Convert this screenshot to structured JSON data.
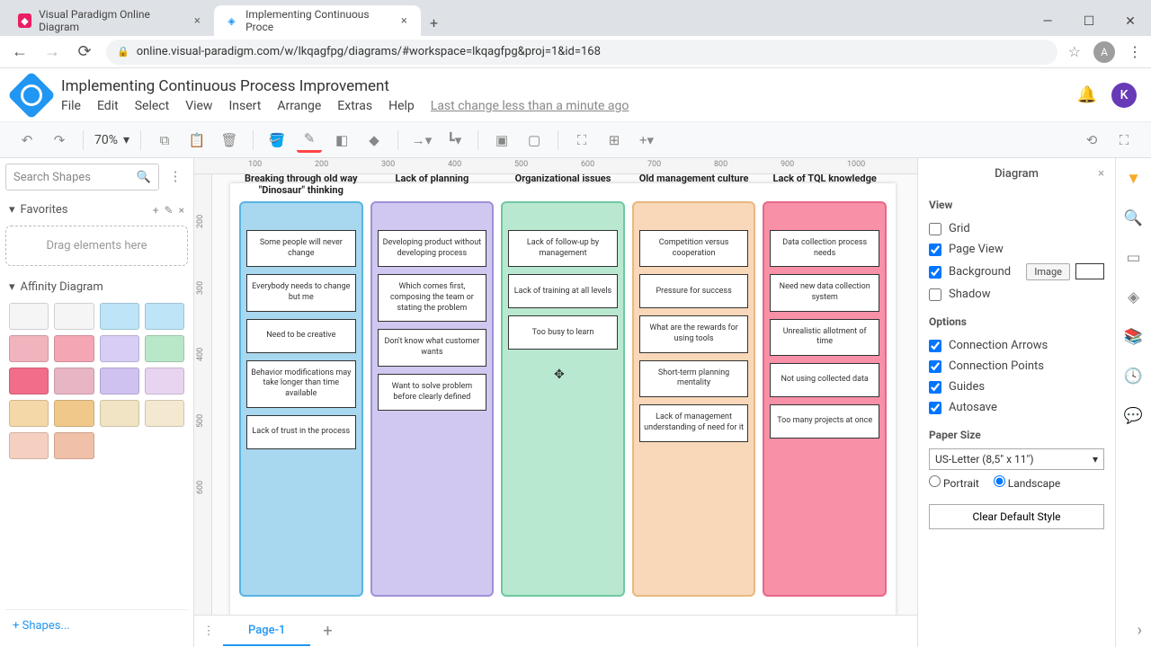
{
  "browser": {
    "tabs": [
      {
        "title": "Visual Paradigm Online Diagram",
        "active": false
      },
      {
        "title": "Implementing Continuous Proce",
        "active": true
      }
    ],
    "url": "online.visual-paradigm.com/w/lkqagfpg/diagrams/#workspace=lkqagfpg&proj=1&id=168",
    "avatar": "A"
  },
  "app": {
    "title": "Implementing Continuous Process Improvement",
    "menus": [
      "File",
      "Edit",
      "Select",
      "View",
      "Insert",
      "Arrange",
      "Extras",
      "Help"
    ],
    "lastChange": "Last change less than a minute ago",
    "userInitial": "K",
    "zoom": "70%"
  },
  "leftPanel": {
    "searchPlaceholder": "Search Shapes",
    "favorites": "Favorites",
    "dropHint": "Drag elements here",
    "sectionName": "Affinity Diagram",
    "moreShapes": "+  Shapes..."
  },
  "rulerH": [
    "100",
    "200",
    "300",
    "400",
    "500",
    "600",
    "700",
    "800",
    "900",
    "1000"
  ],
  "rulerV": [
    "200",
    "300",
    "400",
    "500",
    "600"
  ],
  "columns": [
    {
      "title": "Breaking through old way \"Dinosaur\" thinking",
      "bg": "#a8d8f0",
      "border": "#5ab4e0",
      "cards": [
        "Some people will never change",
        "Everybody needs to change but me",
        "Need to be creative",
        "Behavior modifications may take longer than time available",
        "Lack of trust in the process"
      ]
    },
    {
      "title": "Lack of planning",
      "bg": "#d0c8f0",
      "border": "#a090d8",
      "cards": [
        "Developing product without developing process",
        "Which comes first, composing the team or stating the problem",
        "Don't know what customer wants",
        "Want to solve problem before clearly defined"
      ]
    },
    {
      "title": "Organizational issues",
      "bg": "#b8e8d0",
      "border": "#70c8a0",
      "cards": [
        "Lack of follow-up by management",
        "Lack of training at all levels",
        "Too busy to learn"
      ]
    },
    {
      "title": "Old management culture",
      "bg": "#f8d8b8",
      "border": "#e8b880",
      "cards": [
        "Competition versus cooperation",
        "Pressure for success",
        "What are the rewards for using tools",
        "Short-term planning mentality",
        "Lack of management understanding of need for it"
      ]
    },
    {
      "title": "Lack of TQL knowledge",
      "bg": "#f890a8",
      "border": "#e86888",
      "cards": [
        "Data collection process needs",
        "Need new data collection system",
        "Unrealistic allotment of time",
        "Not using collected data",
        "Too many projects at once"
      ]
    }
  ],
  "rightPanel": {
    "title": "Diagram",
    "sectionView": "View",
    "grid": "Grid",
    "pageView": "Page View",
    "background": "Background",
    "imageBtn": "Image",
    "shadow": "Shadow",
    "sectionOptions": "Options",
    "connArrows": "Connection Arrows",
    "connPoints": "Connection Points",
    "guides": "Guides",
    "autosave": "Autosave",
    "paperSize": "Paper Size",
    "paperValue": "US-Letter (8,5\" x 11\")",
    "portrait": "Portrait",
    "landscape": "Landscape",
    "clearBtn": "Clear Default Style"
  },
  "pageTab": "Page-1",
  "shapeColors": [
    "#f5f5f5",
    "#f5f5f5",
    "#bde4f7",
    "#bde4f7",
    "#f1b3bd",
    "#f5a6b4",
    "#d8cef5",
    "#b9e8c8",
    "#f16d89",
    "#e8b5c4",
    "#cfc1f0",
    "#e8d3f0",
    "#f5d8a8",
    "#f0c98a",
    "#f0e4c4",
    "#f5e8d0",
    "#f5d0c0",
    "#f0c0a8",
    "",
    ""
  ]
}
